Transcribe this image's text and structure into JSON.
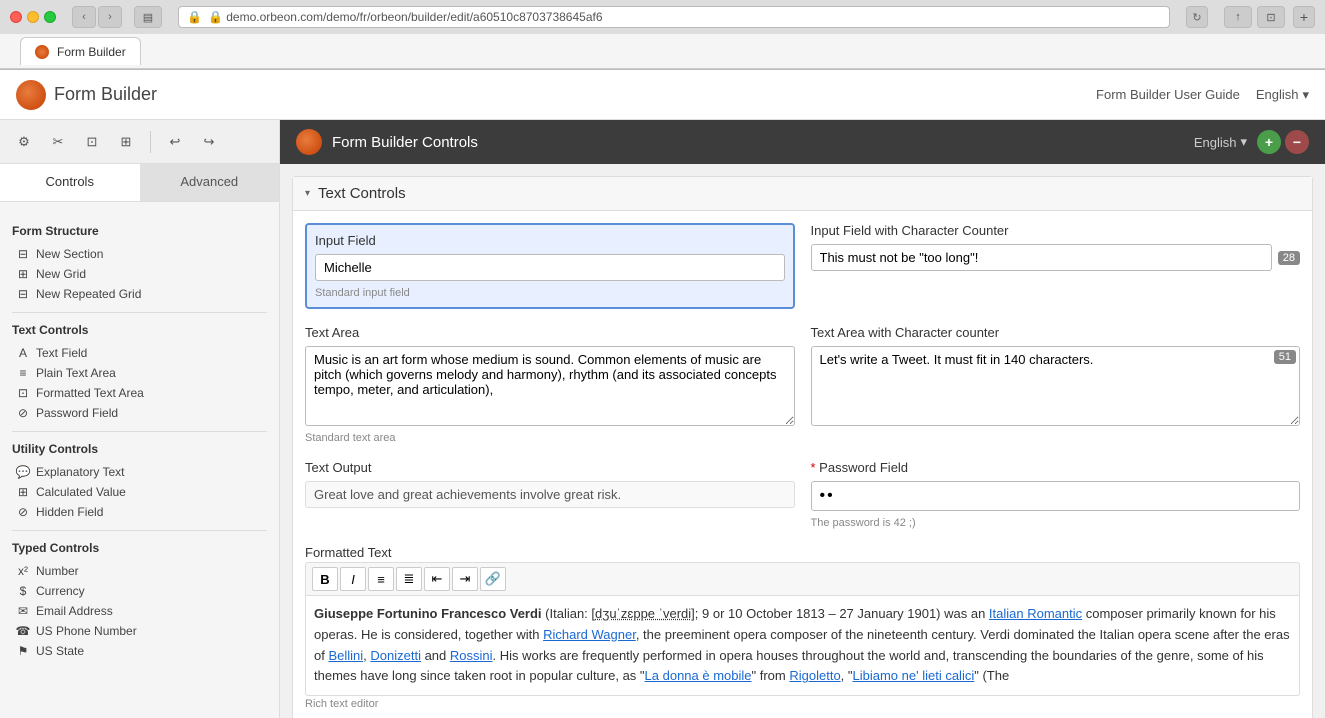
{
  "browser": {
    "url": "demo.orbeon.com/demo/fr/orbeon/builder/edit/a60510c8703738645af6",
    "url_display": "🔒 demo.orbeon.com/demo/fr/orbeon/builder/edit/a60510c8703738645af6"
  },
  "app": {
    "title": "Form Builder",
    "nav_link": "Form Builder User Guide",
    "nav_lang": "English",
    "nav_lang_arrow": "▾"
  },
  "form_header": {
    "title": "Form Builder Controls",
    "lang_label": "English",
    "lang_arrow": "▾",
    "plus": "+",
    "minus": "−"
  },
  "sidebar": {
    "tab_controls": "Controls",
    "tab_advanced": "Advanced",
    "form_structure_title": "Form Structure",
    "form_structure_items": [
      {
        "icon": "section",
        "label": "New Section"
      },
      {
        "icon": "grid",
        "label": "New Grid"
      },
      {
        "icon": "repgrid",
        "label": "New Repeated Grid"
      }
    ],
    "text_controls_title": "Text Controls",
    "text_controls_items": [
      {
        "icon": "text",
        "label": "Text Field"
      },
      {
        "icon": "plain",
        "label": "Plain Text Area"
      },
      {
        "icon": "formatted",
        "label": "Formatted Text Area"
      },
      {
        "icon": "password",
        "label": "Password Field"
      }
    ],
    "utility_controls_title": "Utility Controls",
    "utility_controls_items": [
      {
        "icon": "explanatory",
        "label": "Explanatory Text"
      },
      {
        "icon": "calc",
        "label": "Calculated Value"
      },
      {
        "icon": "hidden",
        "label": "Hidden Field"
      }
    ],
    "typed_controls_title": "Typed Controls",
    "typed_controls_items": [
      {
        "icon": "number",
        "label": "Number"
      },
      {
        "icon": "currency",
        "label": "Currency"
      },
      {
        "icon": "email",
        "label": "Email Address"
      },
      {
        "icon": "phone",
        "label": "US Phone Number"
      },
      {
        "icon": "state",
        "label": "US State"
      }
    ]
  },
  "section": {
    "title": "Text Controls",
    "toggle": "▾"
  },
  "controls": {
    "input_field": {
      "label": "Input Field",
      "value": "Michelle",
      "hint": "Standard input field"
    },
    "input_counter": {
      "label": "Input Field with Character Counter",
      "value": "This must not be \"too long\"!",
      "count": "28"
    },
    "textarea": {
      "label": "Text Area",
      "value": "Music is an art form whose medium is sound. Common elements of music are pitch (which governs melody and harmony), rhythm (and its associated concepts tempo, meter, and articulation),",
      "hint": "Standard text area"
    },
    "textarea_counter": {
      "label": "Text Area with Character counter",
      "value": "Let's write a Tweet. It must fit in 140 characters.",
      "count": "51"
    },
    "text_output": {
      "label": "Text Output",
      "value": "Great love and great achievements involve great risk."
    },
    "password": {
      "label": "Password Field",
      "required": true,
      "value": "••",
      "hint": "The password is 42 ;)"
    },
    "formatted_text": {
      "label": "Formatted Text",
      "hint": "Rich text editor",
      "content": "Giuseppe Fortunino Francesco Verdi (Italian: [dʒuˈzɛppe ˈverdi]; 9 or 10 October 1813 – 27 January 1901) was an Italian Romantic composer primarily known for his operas. He is considered, together with Richard Wagner, the preeminent opera composer of the nineteenth century. Verdi dominated the Italian opera scene after the eras of Bellini, Donizetti and Rossini. His works are frequently performed in opera houses throughout the world and, transcending the boundaries of the genre, some of his themes have long since taken root in popular culture, as \"La donna è mobile\" from Rigoletto, \"Libiamo ne' lieti calici\" (The",
      "toolbar": {
        "bold": "B",
        "italic": "I",
        "ul": "≡",
        "ol": "≣",
        "indent_left": "⇤",
        "indent_right": "⇥",
        "link": "🔗"
      }
    }
  },
  "toolbar": {
    "icons": [
      "⚙",
      "✂",
      "⊡",
      "⊞",
      "↩",
      "↪"
    ]
  }
}
